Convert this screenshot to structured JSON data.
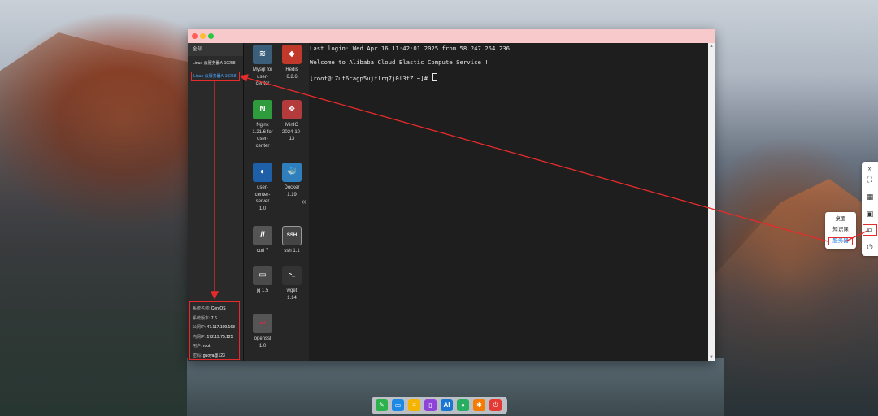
{
  "sidebar": {
    "all_label": "全部",
    "items": [
      {
        "label": "Linux-云服务器A-10258"
      },
      {
        "label": "Linux-云服务器A-10258"
      }
    ],
    "info": {
      "os_name_label": "系统名称:",
      "os_name": "CentOS",
      "os_version_label": "系统版本:",
      "os_version": "7.6",
      "public_ip_label": "公网IP:",
      "public_ip": "47.117.109.168",
      "private_ip_label": "内网IP:",
      "private_ip": "172.19.75.125",
      "user_label": "用户:",
      "user": "root",
      "password_label": "密码:",
      "password": "guoya@123"
    }
  },
  "apps": [
    {
      "name": "Mysql for user-center",
      "icon": "mysql-icon"
    },
    {
      "name": "Redis 6.2.6",
      "icon": "redis-icon"
    },
    {
      "name": "Nginx 1.21.6 for user-center",
      "icon": "nginx-icon"
    },
    {
      "name": "MinIO 2024-10-13",
      "icon": "minio-icon"
    },
    {
      "name": "user-center-server 1.0",
      "icon": "user-center-server-icon"
    },
    {
      "name": "Docker 1.19",
      "icon": "docker-icon"
    },
    {
      "name": "curl 7",
      "icon": "curl-icon"
    },
    {
      "name": "ssh 1.1",
      "icon": "ssh-icon"
    },
    {
      "name": "jq 1.5",
      "icon": "jq-icon"
    },
    {
      "name": "wget 1.14",
      "icon": "wget-icon"
    },
    {
      "name": "openssl 1.0",
      "icon": "openssl-icon"
    }
  ],
  "app_labels": {
    "mysql": [
      "Mysql for",
      "user-",
      "center"
    ],
    "redis": [
      "Redis",
      "6.2.6"
    ],
    "nginx": [
      "Nginx",
      "1.21.6 for",
      "user-",
      "center"
    ],
    "minio": [
      "MinIO",
      "2024-10-",
      "13"
    ],
    "ucs": [
      "user-",
      "center-",
      "server",
      "1.0"
    ],
    "docker": [
      "Docker",
      "1.19"
    ],
    "curl": [
      "curl 7"
    ],
    "ssh": [
      "ssh 1.1"
    ],
    "jq": [
      "jq 1.5"
    ],
    "wget": [
      "wget",
      "1.14"
    ],
    "openssl": [
      "openssl",
      "1.0"
    ]
  },
  "icon_glyphs": {
    "ssh": "SSH",
    "curl": "//",
    "wget": ">_",
    "openssl": "ssl",
    "nginx": "N",
    "minio": "❖"
  },
  "terminal": {
    "line1": "Last login: Wed Apr 16 11:42:01 2025 from 58.247.254.236",
    "line2": "Welcome to Alibaba Cloud Elastic Compute Service !",
    "line3": "[root@iZuf6cagp5ujflrq7j0l3fZ ~]# "
  },
  "collapse_glyph": "«",
  "right_toolbar": {
    "expand": "»",
    "fullscreen": "⛶",
    "apps": "▦",
    "layout": "▣",
    "copy": "⧉",
    "power": "⏻"
  },
  "popup": {
    "items": [
      "桌面",
      "知识课",
      "服务器"
    ]
  },
  "dock": {
    "items": [
      {
        "icon": "app-store-icon",
        "color": "#2bb24c"
      },
      {
        "icon": "chat-icon",
        "color": "#1e88e5"
      },
      {
        "icon": "notes-icon",
        "color": "#f5b400"
      },
      {
        "icon": "course-icon",
        "color": "#8e44d8"
      },
      {
        "icon": "ai-icon",
        "color": "#1976d2"
      },
      {
        "icon": "message-icon",
        "color": "#27ae60"
      },
      {
        "icon": "settings-icon",
        "color": "#f57c00"
      },
      {
        "icon": "power-icon",
        "color": "#e53935"
      }
    ],
    "ai_label": "AI"
  },
  "colors": {
    "annotation": "#e52b2b",
    "titlebar": "#f7c9cb",
    "link": "#4aa3ff"
  }
}
